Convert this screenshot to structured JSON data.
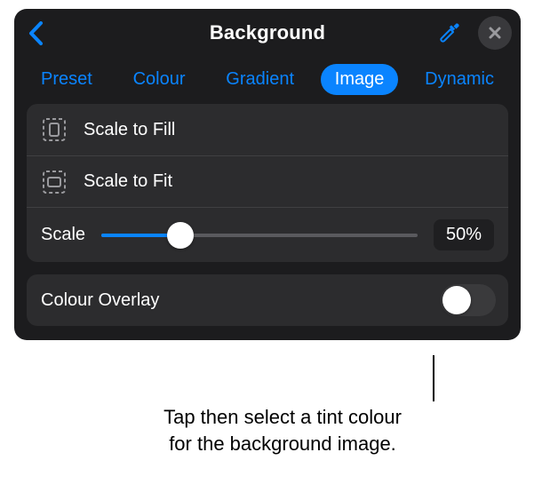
{
  "header": {
    "title": "Background"
  },
  "tabs": [
    {
      "label": "Preset",
      "active": false
    },
    {
      "label": "Colour",
      "active": false
    },
    {
      "label": "Gradient",
      "active": false
    },
    {
      "label": "Image",
      "active": true
    },
    {
      "label": "Dynamic",
      "active": false
    }
  ],
  "options": {
    "scaleToFill": "Scale to Fill",
    "scaleToFit": "Scale to Fit"
  },
  "scale": {
    "label": "Scale",
    "value_text": "50%",
    "percent": 25
  },
  "overlay": {
    "label": "Colour Overlay",
    "on": false
  },
  "callout": {
    "line1": "Tap then select a tint colour",
    "line2": "for the background image."
  }
}
